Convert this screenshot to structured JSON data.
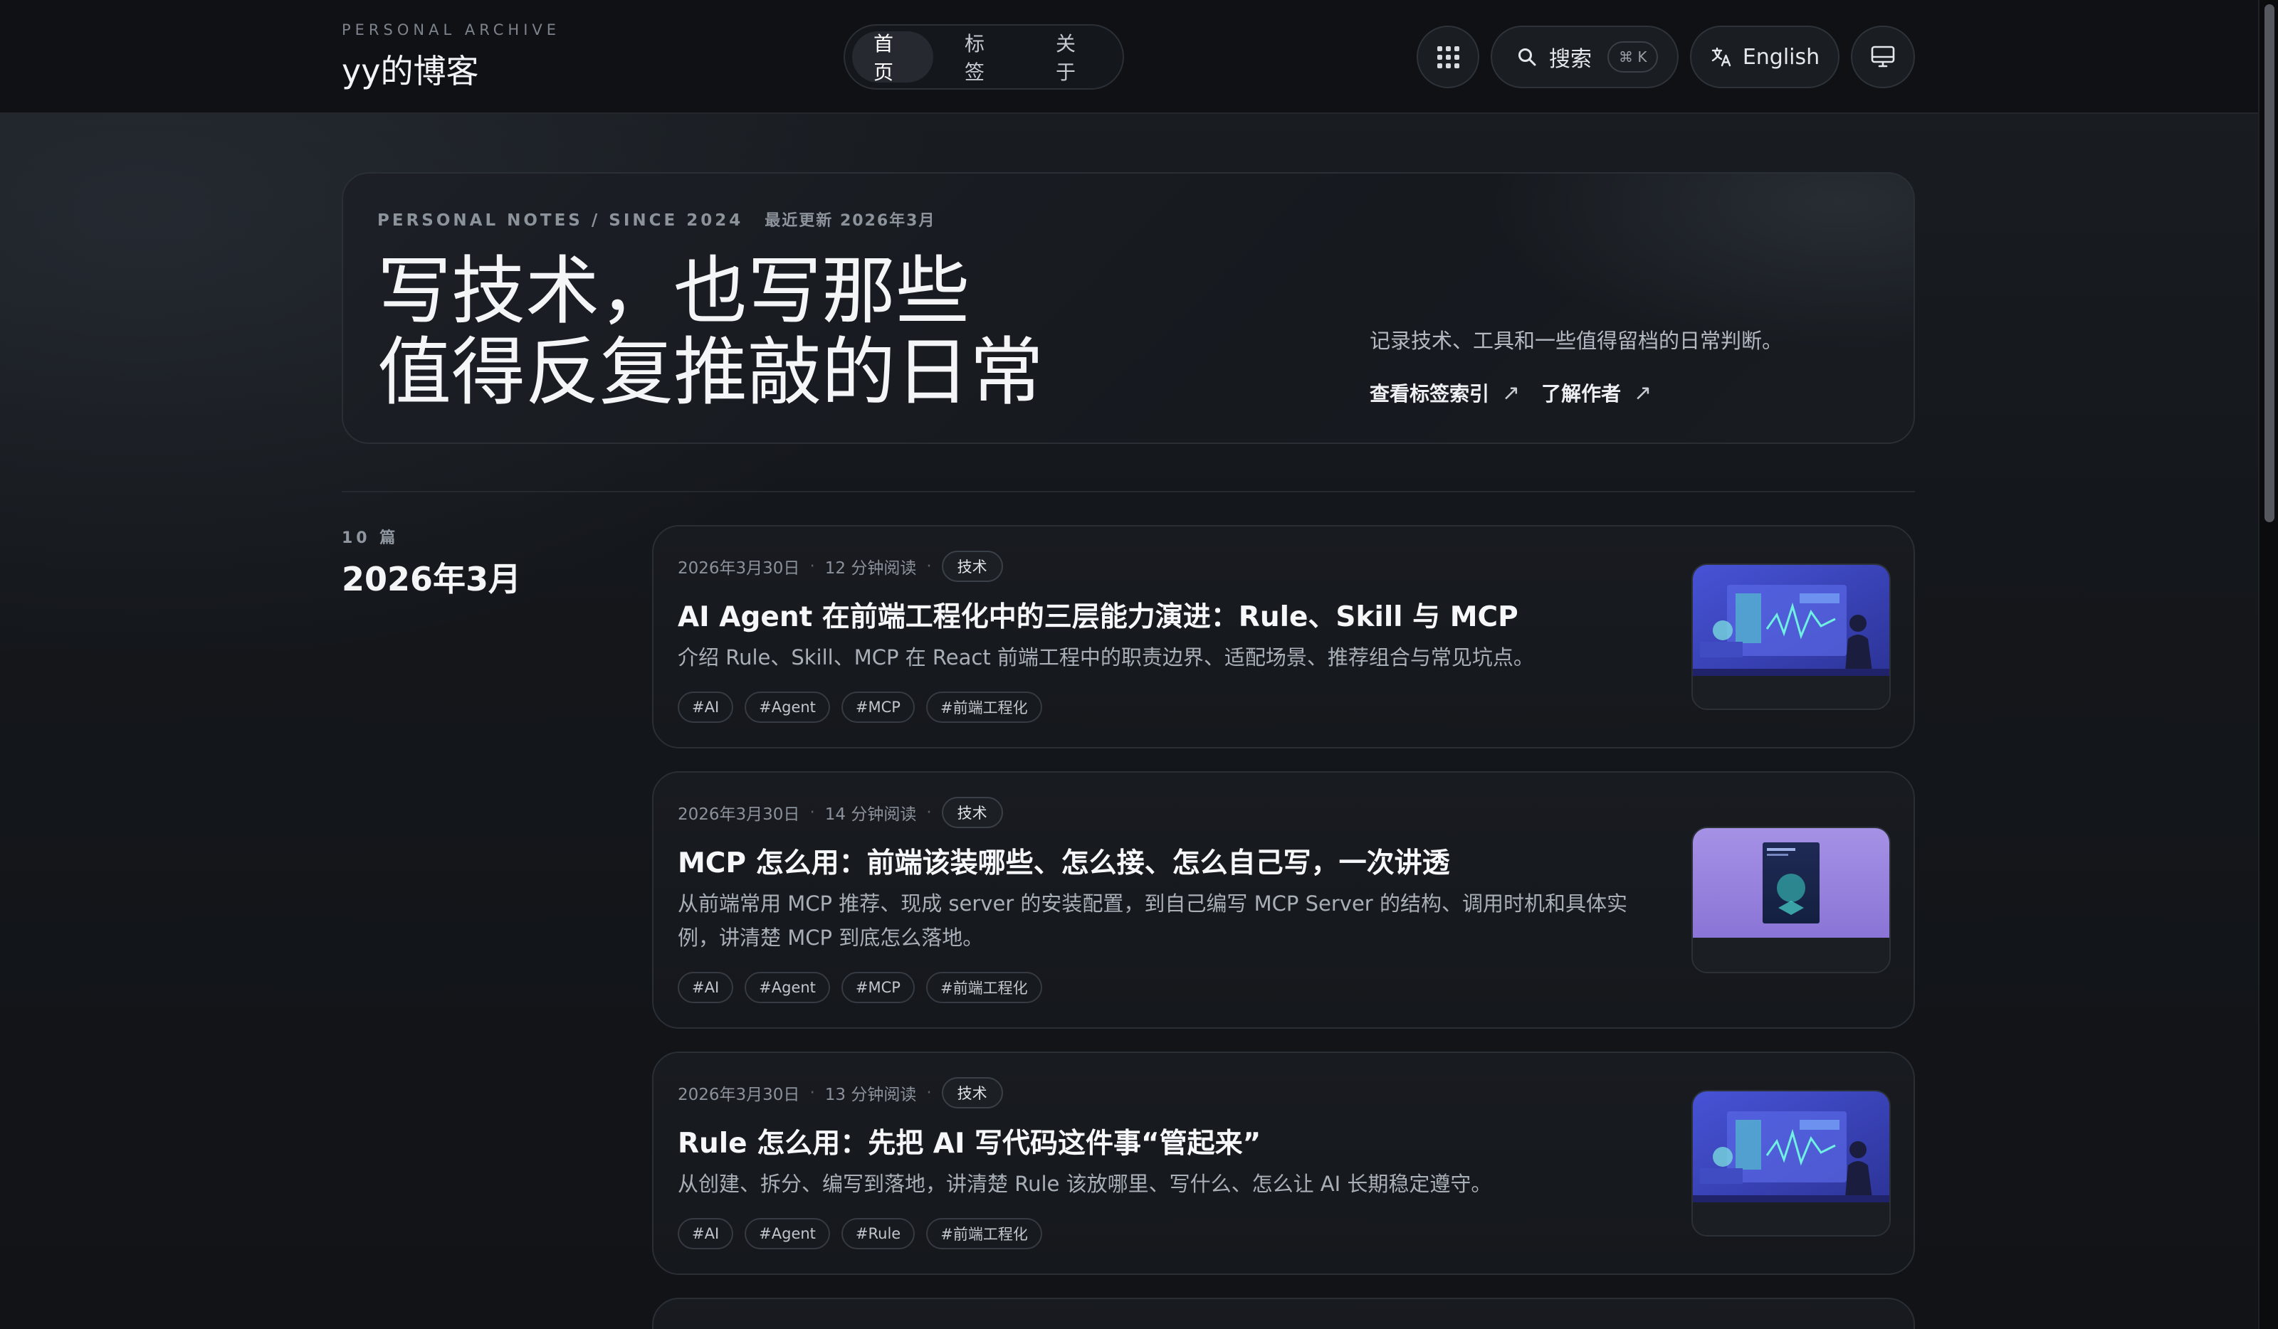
{
  "header": {
    "kicker": "PERSONAL ARCHIVE",
    "site_name": "yy的博客",
    "nav": [
      {
        "label": "首页",
        "active": true
      },
      {
        "label": "标签",
        "active": false
      },
      {
        "label": "关于",
        "active": false
      }
    ],
    "search_label": "搜索",
    "search_shortcut": "⌘ K",
    "language_label": "English",
    "icons": {
      "apps": "grid-icon",
      "search": "search-icon",
      "language": "translate-icon",
      "display": "monitor-icon"
    }
  },
  "hero": {
    "kicker": "PERSONAL NOTES / SINCE 2024",
    "updated": "最近更新 2026年3月",
    "title_line1": "写技术，也写那些",
    "title_line2": "值得反复推敲的日常",
    "description": "记录技术、工具和一些值得留档的日常判断。",
    "link_tags": "查看标签索引",
    "link_author": "了解作者",
    "link_arrow": "↗"
  },
  "month": {
    "count": "10 篇",
    "title": "2026年3月"
  },
  "articles": [
    {
      "date": "2026年3月30日",
      "read_time": "12 分钟阅读",
      "category": "技术",
      "title": "AI Agent 在前端工程化中的三层能力演进：Rule、Skill 与 MCP",
      "summary": "介绍 Rule、Skill、MCP 在 React 前端工程中的职责边界、适配场景、推荐组合与常见坑点。",
      "tags": [
        "#AI",
        "#Agent",
        "#MCP",
        "#前端工程化"
      ],
      "thumb": "dashboard-illustration"
    },
    {
      "date": "2026年3月30日",
      "read_time": "14 分钟阅读",
      "category": "技术",
      "title": "MCP 怎么用：前端该装哪些、怎么接、怎么自己写，一次讲透",
      "summary": "从前端常用 MCP 推荐、现成 server 的安装配置，到自己编写 MCP Server 的结构、调用时机和具体实例，讲清楚 MCP 到底怎么落地。",
      "tags": [
        "#AI",
        "#Agent",
        "#MCP",
        "#前端工程化"
      ],
      "thumb": "book-illustration"
    },
    {
      "date": "2026年3月30日",
      "read_time": "13 分钟阅读",
      "category": "技术",
      "title": "Rule 怎么用：先把 AI 写代码这件事“管起来”",
      "summary": "从创建、拆分、编写到落地，讲清楚 Rule 该放哪里、写什么、怎么让 AI 长期稳定遵守。",
      "tags": [
        "#AI",
        "#Agent",
        "#Rule",
        "#前端工程化"
      ],
      "thumb": "dashboard-illustration"
    }
  ],
  "colors": {
    "background": "#121519",
    "card": "#181b20",
    "border": "#2a2f36",
    "text": "#f4f5f7",
    "muted": "#8c929b",
    "thumb_blue": "#3a44c8",
    "thumb_purple": "#9b87df"
  }
}
